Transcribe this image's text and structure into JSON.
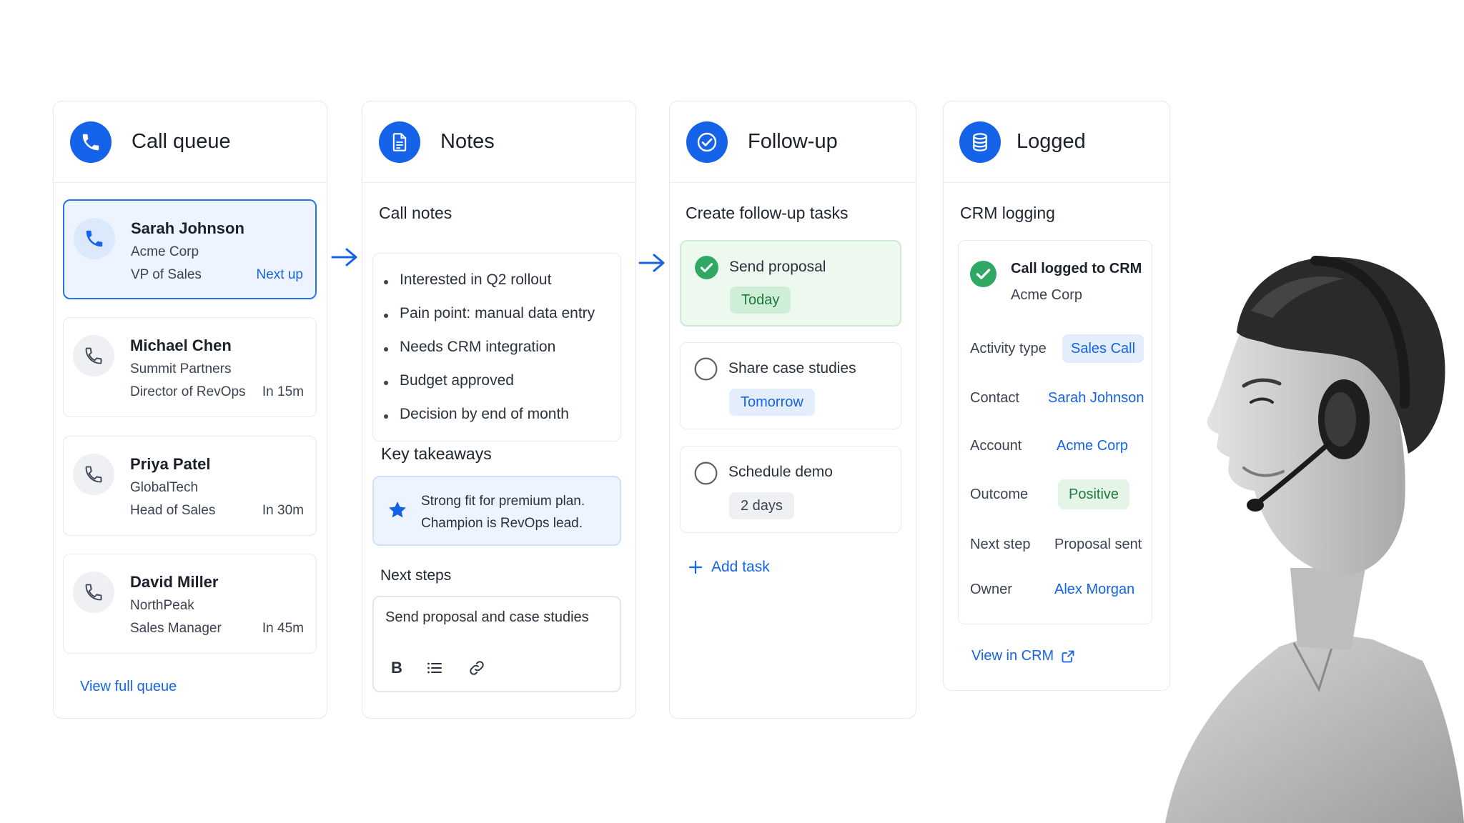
{
  "colors": {
    "accent": "#1463e8",
    "success": "#2ea862",
    "success_bg": "#e4f5e8",
    "chip_blue_bg": "#e3edfc",
    "chip_gray_bg": "#eef0f3"
  },
  "queue": {
    "title": "Call queue",
    "head_icon": "phone-icon",
    "items": [
      {
        "name": "Sarah Johnson",
        "company": "Acme Corp",
        "role": "VP of Sales",
        "time": "Next up"
      },
      {
        "name": "Michael Chen",
        "company": "Summit Partners",
        "role": "Director of RevOps",
        "time": "In 15m"
      },
      {
        "name": "Priya Patel",
        "company": "GlobalTech",
        "role": "Head of Sales",
        "time": "In 30m"
      },
      {
        "name": "David Miller",
        "company": "NorthPeak",
        "role": "Sales Manager",
        "time": "In 45m"
      }
    ],
    "view_all": "View full queue"
  },
  "notes": {
    "title": "Notes",
    "head_icon": "document-icon",
    "call_notes_title": "Call notes",
    "bullets": [
      "Interested in Q2 rollout",
      "Pain point: manual data entry",
      "Needs CRM integration",
      "Budget approved",
      "Decision by end of month"
    ],
    "takeaways_title": "Key takeaways",
    "takeaway": "Strong fit for premium plan. Champion is RevOps lead.",
    "next_steps_title": "Next steps",
    "next_steps_value": "Send proposal and case studies",
    "toolbar": {
      "bold": "B"
    }
  },
  "followup": {
    "title": "Follow-up",
    "head_icon": "check-circle-icon",
    "section_title": "Create follow-up tasks",
    "tasks": [
      {
        "title": "Send proposal",
        "due": "Today",
        "done": true
      },
      {
        "title": "Share case studies",
        "due": "Tomorrow",
        "done": false
      },
      {
        "title": "Schedule demo",
        "due": "2 days",
        "done": false
      }
    ],
    "add_task": "Add task"
  },
  "logged": {
    "title": "Logged",
    "head_icon": "database-icon",
    "section_title": "CRM logging",
    "status_title": "Call logged to CRM",
    "status_sub": "Acme Corp",
    "fields": [
      {
        "label": "Activity type",
        "value": "Sales Call"
      },
      {
        "label": "Contact",
        "value": "Sarah Johnson"
      },
      {
        "label": "Account",
        "value": "Acme Corp"
      },
      {
        "label": "Outcome",
        "value": "Positive"
      },
      {
        "label": "Next step",
        "value": "Proposal sent"
      },
      {
        "label": "Owner",
        "value": "Alex Morgan"
      }
    ],
    "view_in_crm": "View in CRM"
  }
}
